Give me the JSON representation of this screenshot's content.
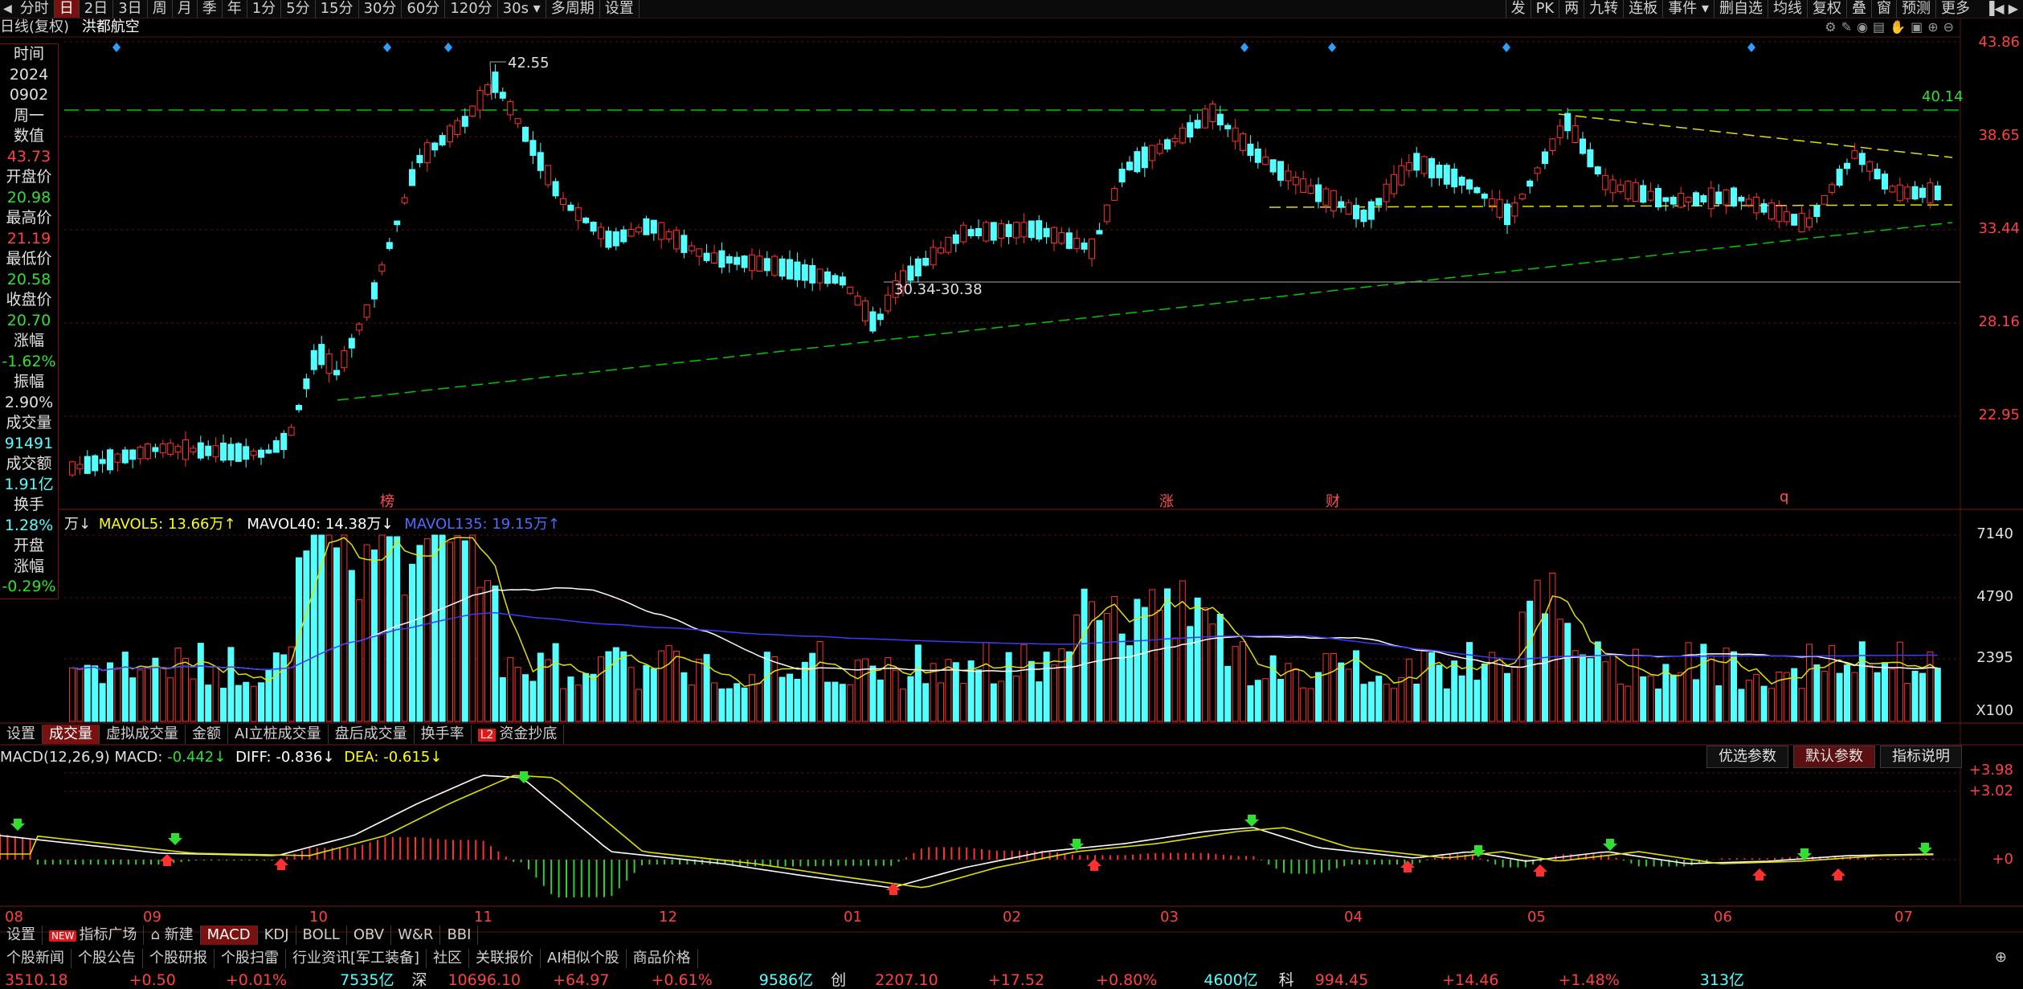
{
  "top_tabs": [
    "分时",
    "日",
    "2日",
    "3日",
    "周",
    "月",
    "季",
    "年",
    "1分",
    "5分",
    "15分",
    "30分",
    "60分",
    "120分",
    "30s ▾",
    "多周期",
    "设置"
  ],
  "top_active": 1,
  "right_tools": [
    "发",
    "PK",
    "两",
    "九转",
    "连板",
    "事件 ▾",
    "删自选",
    "均线",
    "复权",
    "叠",
    "窗",
    "预测",
    "更多"
  ],
  "header": {
    "period": "日线(复权)",
    "stock": "洪都航空"
  },
  "info_panel": {
    "items": [
      {
        "label": "时间",
        "value": "2024"
      },
      {
        "label": "",
        "value": "0902"
      },
      {
        "label": "周一",
        "value": ""
      },
      {
        "label": "数值",
        "value": "43.73"
      },
      {
        "label": "开盘价",
        "value": "20.98"
      },
      {
        "label": "最高价",
        "value": "21.19"
      },
      {
        "label": "最低价",
        "value": "20.58"
      },
      {
        "label": "收盘价",
        "value": "20.70"
      },
      {
        "label": "涨幅",
        "value": "-1.62%"
      },
      {
        "label": "振幅",
        "value": "2.90%"
      },
      {
        "label": "成交量",
        "value": "91491"
      },
      {
        "label": "成交额",
        "value": "1.91亿"
      },
      {
        "label": "换手",
        "value": "1.28%"
      },
      {
        "label": "开盘",
        "value": ""
      },
      {
        "label": "涨幅",
        "value": "-0.29%"
      }
    ]
  },
  "price_axis": [
    "43.86",
    "38.65",
    "33.44",
    "28.16",
    "22.95"
  ],
  "annotations": {
    "high": "42.55",
    "range": "30.34-30.38",
    "res": "40.14"
  },
  "events": [
    "榜",
    "涨",
    "财",
    "q"
  ],
  "vol_legend": {
    "v0": "万↓",
    "mavol5_label": "MAVOL5:",
    "mavol5": "13.66万↑",
    "mavol40_label": "MAVOL40:",
    "mavol40": "14.38万↓",
    "mavol135_label": "MAVOL135:",
    "mavol135": "19.15万↑"
  },
  "vol_axis": [
    "7140",
    "4790",
    "2395",
    "X100"
  ],
  "vol_tabs": [
    "设置",
    "成交量",
    "虚拟成交量",
    "金额",
    "AI立桩成交量",
    "盘后成交量",
    "换手率",
    "资金抄底"
  ],
  "vol_tab_active": 1,
  "macd_legend": {
    "name": "MACD(12,26,9)",
    "macd_label": "MACD:",
    "macd": "-0.442↓",
    "diff_label": "DIFF:",
    "diff": "-0.836↓",
    "dea_label": "DEA:",
    "dea": "-0.615↓"
  },
  "macd_params": [
    "优选参数",
    "默认参数",
    "指标说明"
  ],
  "macd_axis": [
    "+3.98",
    "+3.02",
    "+0"
  ],
  "x_axis": [
    "08",
    "09",
    "10",
    "11",
    "12",
    "01",
    "02",
    "03",
    "04",
    "05",
    "06",
    "07"
  ],
  "ind_tabs": [
    "设置",
    "指标广场",
    "新建",
    "MACD",
    "KDJ",
    "BOLL",
    "OBV",
    "W&R",
    "BBI"
  ],
  "ind_active": 3,
  "news_tabs": [
    "个股新闻",
    "个股公告",
    "个股研报",
    "个股扫雷",
    "行业资讯[军工装备]",
    "社区",
    "关联报价",
    "AI相似个股",
    "商品价格"
  ],
  "status": {
    "sh_val": "3510.18",
    "sh_chg": "+0.50",
    "sh_pct": "+0.01%",
    "sh_amt": "7535亿",
    "sz_name": "深",
    "sz_val": "10696.10",
    "sz_chg": "+64.97",
    "sz_pct": "+0.61%",
    "sz_amt": "9586亿",
    "cy_name": "创",
    "cy_val": "2207.10",
    "cy_chg": "+17.52",
    "cy_pct": "+0.80%",
    "cy_amt": "4600亿",
    "kc_name": "科",
    "kc_val": "994.45",
    "kc_chg": "+14.46",
    "kc_pct": "+1.48%",
    "kc_amt": "313亿"
  },
  "colors": {
    "up": "#ff3030",
    "down": "#54ffff",
    "accent": "#7a1111",
    "ma5": "#ffff00",
    "ma40": "#ffffff",
    "ma135": "#3030ff"
  }
}
